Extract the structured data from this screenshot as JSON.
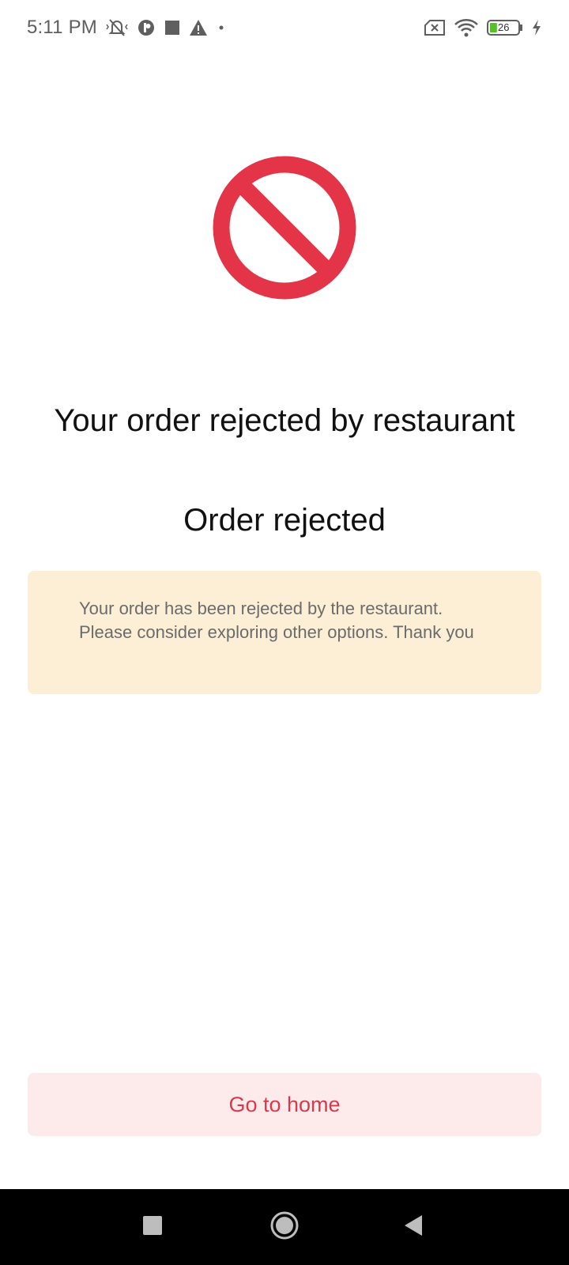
{
  "status_bar": {
    "time": "5:11 PM",
    "left_icons": [
      "vibrate-off-icon",
      "app-notification-icon",
      "square-notification-icon",
      "warning-icon",
      "dot-icon"
    ],
    "right_icons": [
      "no-sim-icon",
      "wifi-icon",
      "battery-icon",
      "charging-icon"
    ],
    "battery_level": "26",
    "battery_color": "#55c02a"
  },
  "main": {
    "status_icon": "prohibited-icon",
    "icon_color": "#e43548",
    "headline": "Your order rejected by restaurant",
    "subheadline": "Order rejected",
    "notice": {
      "text": "Your order has been rejected by the restaurant. Please consider exploring other options. Thank you",
      "background": "#fdefd5"
    },
    "home_button_label": "Go to home",
    "accent_color": "#d9384d"
  },
  "nav_bar": {
    "buttons": [
      "recents-icon",
      "home-icon",
      "back-icon"
    ]
  }
}
